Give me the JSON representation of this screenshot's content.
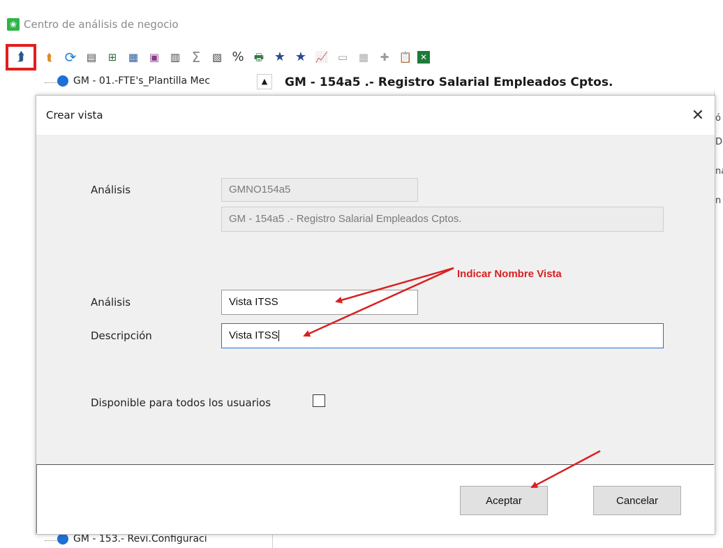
{
  "app": {
    "title": "Centro de análisis de negocio",
    "logo_icon": "app-logo-icon"
  },
  "toolbar": {
    "icons": [
      "create-view-icon",
      "import-icon",
      "refresh-icon",
      "list-icon",
      "tree-icon",
      "export-icon",
      "calendar-icon",
      "table-icon",
      "sum-icon",
      "report-icon",
      "percent-icon",
      "print-icon",
      "favorite-icon",
      "remove-favorite-icon",
      "chart-icon",
      "window-icon",
      "grid-icon",
      "puzzle-icon",
      "clipboard-icon",
      "excel-icon"
    ],
    "glyphs": [
      "⮭",
      "⮬",
      "⟳",
      "▤",
      "⊞",
      "▦",
      "▣",
      "▥",
      "Σ",
      "▧",
      "%",
      "🖶",
      "★",
      "★",
      "📈",
      "▭",
      "▦",
      "✚",
      "📋",
      "✕"
    ],
    "highlight_color": "#e41d1d"
  },
  "tree": {
    "items": [
      {
        "label": "GM - 01.-FTE's_Plantilla Mec"
      },
      {
        "label": "GM - 153.- Revi.Configuraci"
      }
    ],
    "dot_color": "#1f6fd6"
  },
  "background": {
    "header": "GM - 154a5 .- Registro Salarial Empleados Cptos.",
    "right_fragments": [
      "ó",
      "De",
      "na",
      "n"
    ]
  },
  "dialog": {
    "title": "Crear vista",
    "close_glyph": "✕",
    "analisis_label": "Análisis",
    "analisis_code": "GMNO154a5",
    "analisis_desc": "GM - 154a5 .- Registro Salarial Empleados Cptos.",
    "name_label": "Análisis",
    "name_value": "Vista ITSS",
    "desc_label": "Descripción",
    "desc_value": "Vista ITSS",
    "available_label": "Disponible para todos los usuarios",
    "available_checked": false,
    "accept_label": "Aceptar",
    "cancel_label": "Cancelar"
  },
  "annotation": {
    "text": "Indicar Nombre Vista",
    "color": "#d92020"
  }
}
